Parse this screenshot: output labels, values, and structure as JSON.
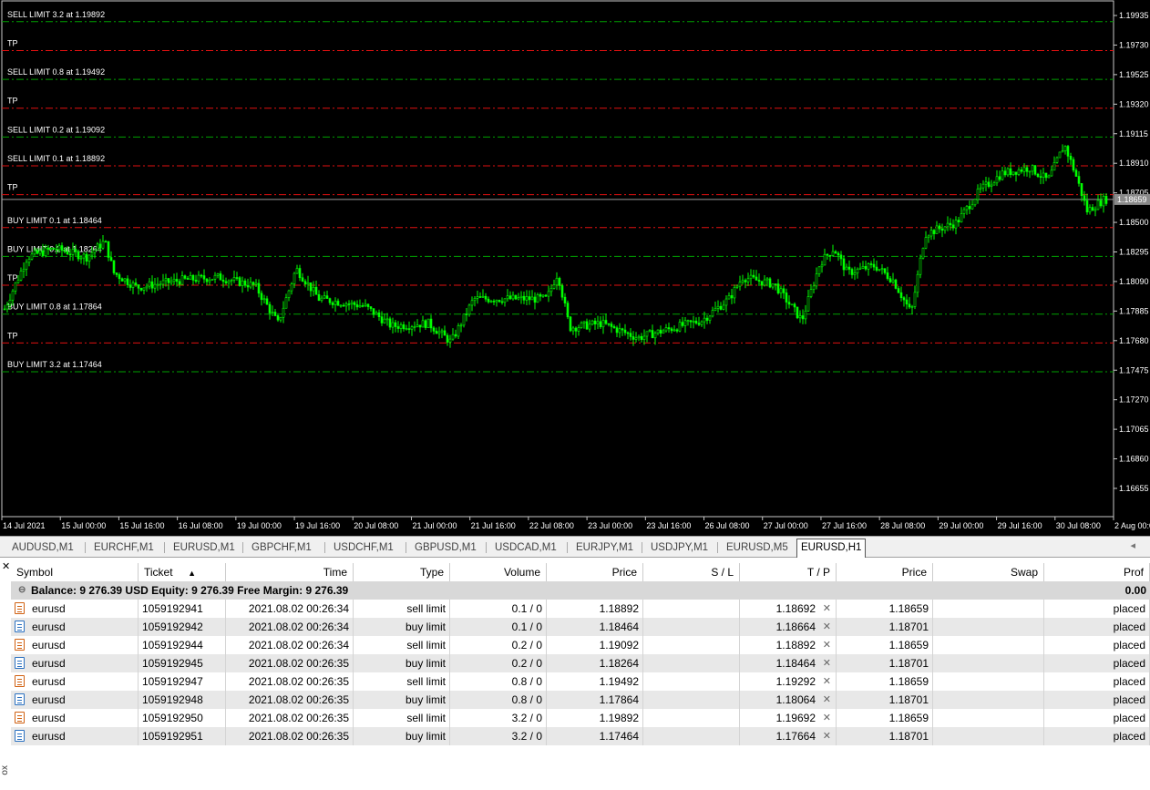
{
  "chart": {
    "price_labels": [
      "1.19935",
      "1.19730",
      "1.19525",
      "1.19320",
      "1.19115",
      "1.18910",
      "1.18705",
      "1.18500",
      "1.18295",
      "1.18090",
      "1.17885",
      "1.17680",
      "1.17475",
      "1.17270",
      "1.17065",
      "1.16860",
      "1.16655"
    ],
    "current_price": "1.18659",
    "time_labels": [
      "14 Jul 2021",
      "15 Jul 00:00",
      "15 Jul 16:00",
      "16 Jul 08:00",
      "19 Jul 00:00",
      "19 Jul 16:00",
      "20 Jul 08:00",
      "21 Jul 00:00",
      "21 Jul 16:00",
      "22 Jul 08:00",
      "23 Jul 00:00",
      "23 Jul 16:00",
      "26 Jul 08:00",
      "27 Jul 00:00",
      "27 Jul 16:00",
      "28 Jul 08:00",
      "29 Jul 00:00",
      "29 Jul 16:00",
      "30 Jul 08:00",
      "2 Aug 00:00"
    ],
    "order_lines": [
      {
        "label": "SELL LIMIT 3.2 at 1.19892",
        "price": 1.19892,
        "kind": "order"
      },
      {
        "label": "TP",
        "price": 1.19692,
        "kind": "tp"
      },
      {
        "label": "SELL LIMIT 0.8 at 1.19492",
        "price": 1.19492,
        "kind": "order"
      },
      {
        "label": "TP",
        "price": 1.19292,
        "kind": "tp"
      },
      {
        "label": "SELL LIMIT 0.2 at 1.19092",
        "price": 1.19092,
        "kind": "order"
      },
      {
        "label": "SELL LIMIT 0.1 at 1.18892",
        "price": 1.18892,
        "kind": "tp"
      },
      {
        "label": "TP",
        "price": 1.18692,
        "kind": "tp"
      },
      {
        "label": "BUY LIMIT 0.1 at 1.18464",
        "price": 1.18464,
        "kind": "tp"
      },
      {
        "label": "BUY LIMIT 0.2 at 1.18264",
        "price": 1.18264,
        "kind": "order"
      },
      {
        "label": "TP",
        "price": 1.18064,
        "kind": "tp"
      },
      {
        "label": "BUY LIMIT 0.8 at 1.17864",
        "price": 1.17864,
        "kind": "order"
      },
      {
        "label": "TP",
        "price": 1.17664,
        "kind": "tp"
      },
      {
        "label": "BUY LIMIT 3.2 at 1.17464",
        "price": 1.17464,
        "kind": "order"
      }
    ],
    "colors": {
      "background": "#000000",
      "candles": "#00ff00",
      "order_line": "#00a000",
      "tp_line": "#e01010",
      "grid_text": "#ffffff"
    }
  },
  "tabs": [
    "AUDUSD,M1",
    "EURCHF,M1",
    "EURUSD,M1",
    "GBPCHF,M1",
    "USDCHF,M1",
    "GBPUSD,M1",
    "USDCAD,M1",
    "EURJPY,M1",
    "USDJPY,M1",
    "EURUSD,M5",
    "EURUSD,H1"
  ],
  "active_tab": "EURUSD,H1",
  "table": {
    "headers": [
      "Symbol",
      "Ticket",
      "Time",
      "Type",
      "Volume",
      "Price",
      "S / L",
      "T / P",
      "Price",
      "Swap",
      "Prof"
    ],
    "balance_text": "Balance: 9 276.39 USD  Equity: 9 276.39  Free Margin: 9 276.39",
    "balance_total": "0.00",
    "rows": [
      {
        "symbol": "eurusd",
        "ticket": "1059192941",
        "time": "2021.08.02 00:26:34",
        "type": "sell limit",
        "volume": "0.1 / 0",
        "price": "1.18892",
        "sl": "",
        "tp": "1.18692",
        "cur": "1.18659",
        "swap": "",
        "profit": "placed"
      },
      {
        "symbol": "eurusd",
        "ticket": "1059192942",
        "time": "2021.08.02 00:26:34",
        "type": "buy limit",
        "volume": "0.1 / 0",
        "price": "1.18464",
        "sl": "",
        "tp": "1.18664",
        "cur": "1.18701",
        "swap": "",
        "profit": "placed"
      },
      {
        "symbol": "eurusd",
        "ticket": "1059192944",
        "time": "2021.08.02 00:26:34",
        "type": "sell limit",
        "volume": "0.2 / 0",
        "price": "1.19092",
        "sl": "",
        "tp": "1.18892",
        "cur": "1.18659",
        "swap": "",
        "profit": "placed"
      },
      {
        "symbol": "eurusd",
        "ticket": "1059192945",
        "time": "2021.08.02 00:26:35",
        "type": "buy limit",
        "volume": "0.2 / 0",
        "price": "1.18264",
        "sl": "",
        "tp": "1.18464",
        "cur": "1.18701",
        "swap": "",
        "profit": "placed"
      },
      {
        "symbol": "eurusd",
        "ticket": "1059192947",
        "time": "2021.08.02 00:26:35",
        "type": "sell limit",
        "volume": "0.8 / 0",
        "price": "1.19492",
        "sl": "",
        "tp": "1.19292",
        "cur": "1.18659",
        "swap": "",
        "profit": "placed"
      },
      {
        "symbol": "eurusd",
        "ticket": "1059192948",
        "time": "2021.08.02 00:26:35",
        "type": "buy limit",
        "volume": "0.8 / 0",
        "price": "1.17864",
        "sl": "",
        "tp": "1.18064",
        "cur": "1.18701",
        "swap": "",
        "profit": "placed"
      },
      {
        "symbol": "eurusd",
        "ticket": "1059192950",
        "time": "2021.08.02 00:26:35",
        "type": "sell limit",
        "volume": "3.2 / 0",
        "price": "1.19892",
        "sl": "",
        "tp": "1.19692",
        "cur": "1.18659",
        "swap": "",
        "profit": "placed"
      },
      {
        "symbol": "eurusd",
        "ticket": "1059192951",
        "time": "2021.08.02 00:26:35",
        "type": "buy limit",
        "volume": "3.2 / 0",
        "price": "1.17464",
        "sl": "",
        "tp": "1.17664",
        "cur": "1.18701",
        "swap": "",
        "profit": "placed"
      }
    ]
  },
  "terminal_label": "ox"
}
